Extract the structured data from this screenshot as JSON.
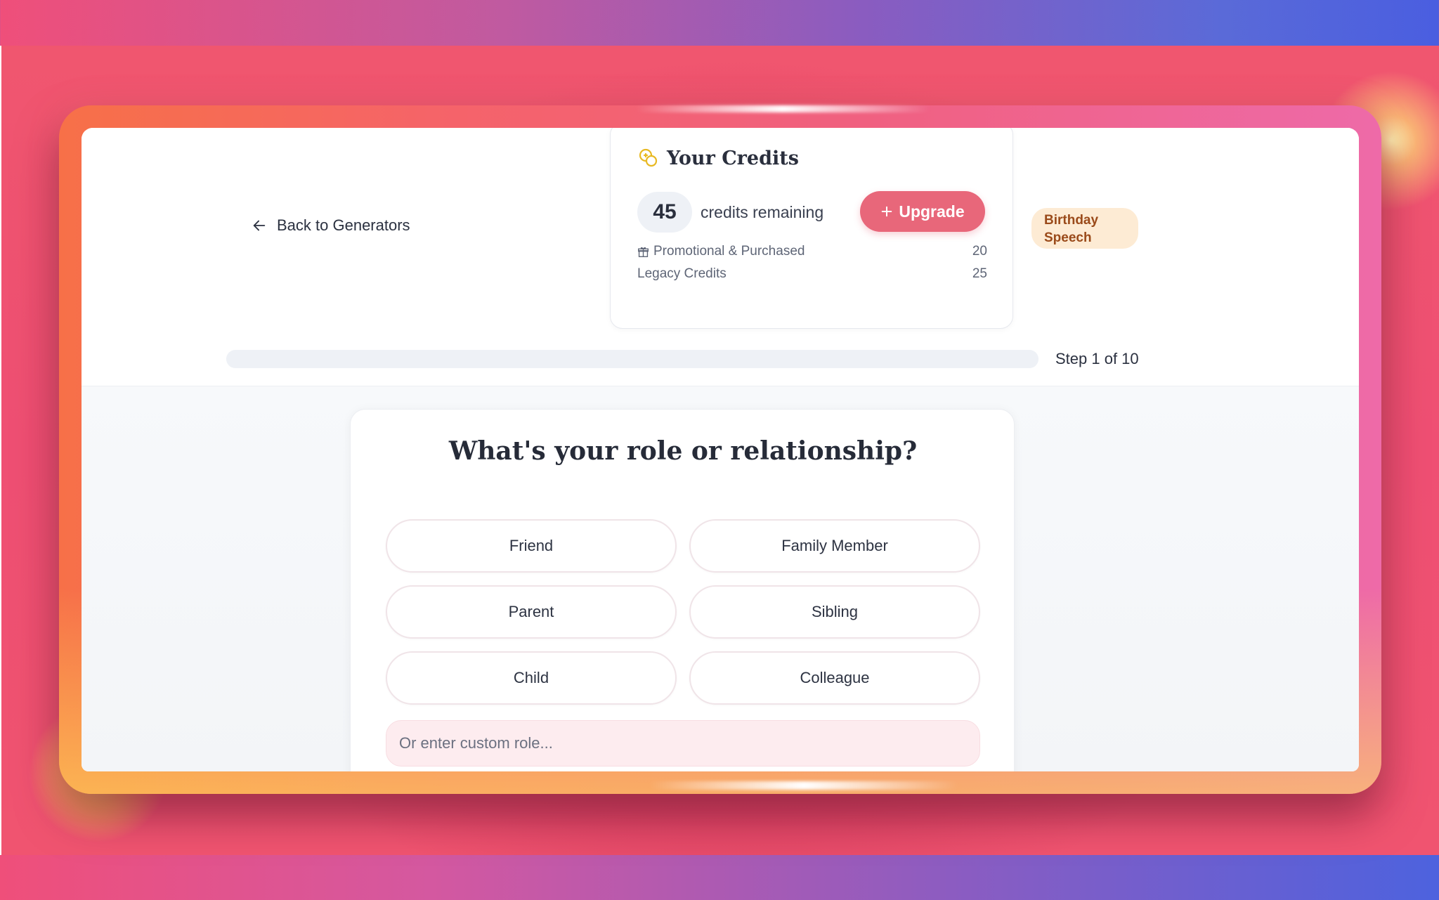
{
  "nav": {
    "back_label": "Back to Generators"
  },
  "credits": {
    "title": "Your Credits",
    "count": "45",
    "remaining_label": "credits remaining",
    "upgrade_label": "Upgrade",
    "rows": [
      {
        "label": "Promotional & Purchased",
        "value": "20"
      },
      {
        "label": "Legacy Credits",
        "value": "25"
      }
    ]
  },
  "badge": {
    "line1": "Birthday",
    "line2": "Speech"
  },
  "progress": {
    "step_text": "Step 1 of 10",
    "fraction": 0.0
  },
  "question": {
    "title": "What's your role or relationship?",
    "options": [
      "Friend",
      "Family Member",
      "Parent",
      "Sibling",
      "Child",
      "Colleague"
    ],
    "custom_placeholder": "Or enter custom role..."
  },
  "colors": {
    "accent": "#e8677a",
    "badge_bg": "#fdebd4",
    "badge_text": "#9a4a1a",
    "coin": "#e8b923"
  }
}
